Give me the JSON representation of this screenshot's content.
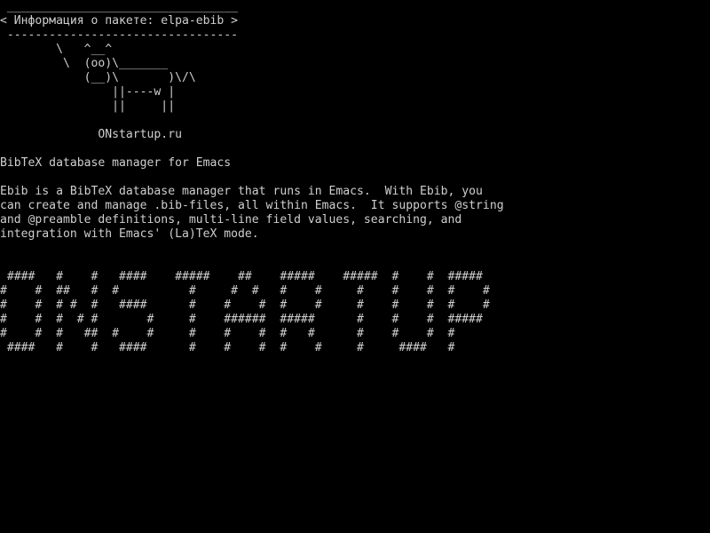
{
  "terminal": {
    "lines": [
      " _________________________________",
      "< Информация о пакете: elpa-ebib >",
      " ---------------------------------",
      "        \\   ^__^",
      "         \\  (oo)\\_______",
      "            (__)\\       )\\/\\",
      "                ||----w |",
      "                ||     ||",
      "",
      "              ONstartup.ru",
      "",
      "BibTeX database manager for Emacs",
      "",
      "Ebib is a BibTeX database manager that runs in Emacs.  With Ebib, you",
      "can create and manage .bib-files, all within Emacs.  It supports @string",
      "and @preamble definitions, multi-line field values, searching, and",
      "integration with Emacs' (La)TeX mode.",
      "",
      "",
      " ####   #    #   ####    #####    ##    #####    #####  #    #  #####",
      "#    #  ##   #  #          #     #  #   #    #     #    #    #  #    #",
      "#    #  # #  #   ####      #    #    #  #    #     #    #    #  #    #",
      "#    #  #  # #       #     #    ######  #####      #    #    #  #####",
      "#    #  #   ##  #    #     #    #    #  #   #      #    #    #  #",
      " ####   #    #   ####      #    #    #  #    #     #     ####   #"
    ]
  }
}
